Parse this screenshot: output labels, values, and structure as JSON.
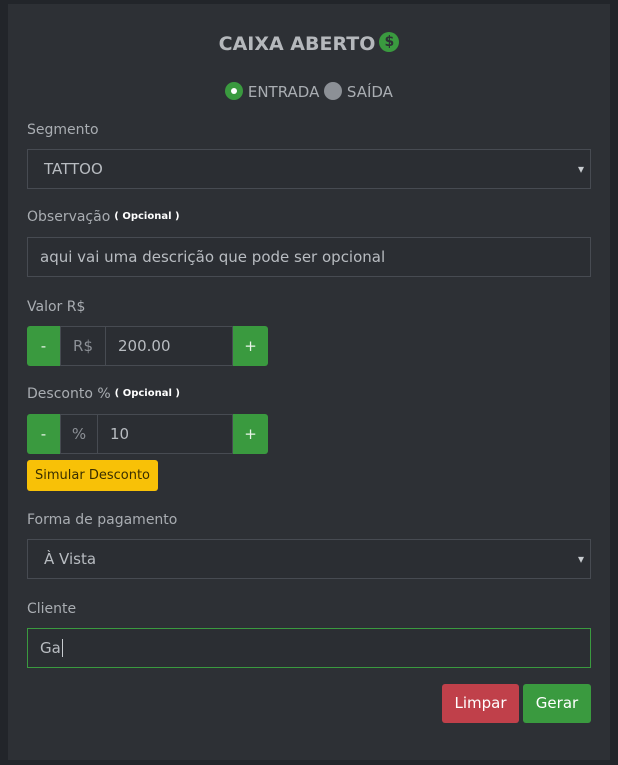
{
  "title": "CAIXA ABERTO",
  "title_icon": "dollar-circle-icon",
  "type_options": {
    "entrada": "ENTRADA",
    "saida": "SAÍDA",
    "selected": "entrada"
  },
  "segmento": {
    "label": "Segmento",
    "value": "TATTOO"
  },
  "observacao": {
    "label": "Observação",
    "optional": "( Opcional )",
    "value": "aqui vai uma descrição que pode ser opcional"
  },
  "valor": {
    "label": "Valor R$",
    "minus": "-",
    "prefix": "R$",
    "value": "200.00",
    "plus": "+"
  },
  "desconto": {
    "label": "Desconto %",
    "optional": "( Opcional )",
    "minus": "-",
    "prefix": "%",
    "value": "10",
    "plus": "+",
    "simulate": "Simular Desconto"
  },
  "pagamento": {
    "label": "Forma de pagamento",
    "value": "À Vista"
  },
  "cliente": {
    "label": "Cliente",
    "value": "Ga"
  },
  "actions": {
    "clear": "Limpar",
    "generate": "Gerar"
  },
  "colors": {
    "background": "#2d3035",
    "success": "#3a9a3f",
    "danger": "#c0404a",
    "warning": "#f8c107"
  }
}
